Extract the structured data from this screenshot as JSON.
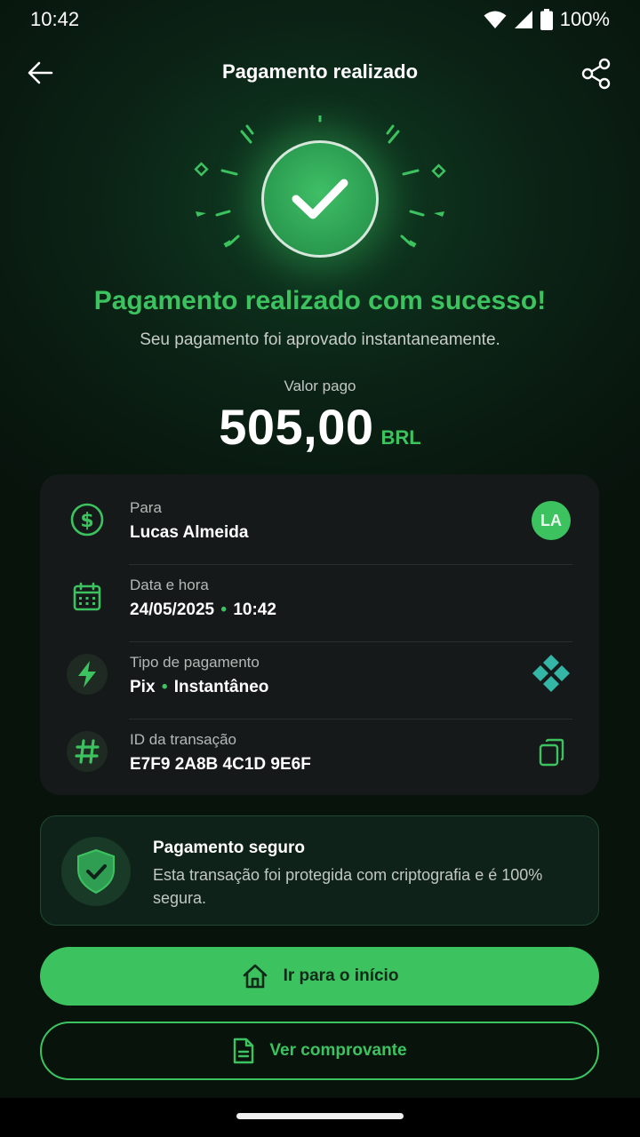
{
  "status_bar": {
    "time": "10:42",
    "battery": "100%"
  },
  "app_bar": {
    "title": "Pagamento realizado"
  },
  "hero": {
    "title": "Pagamento realizado com sucesso!",
    "subtitle": "Seu pagamento foi aprovado instantaneamente."
  },
  "amount": {
    "label": "Valor pago",
    "value": "505,00",
    "currency": "BRL"
  },
  "details": {
    "recipient": {
      "label": "Para",
      "value": "Lucas Almeida",
      "avatar_initials": "LA"
    },
    "datetime": {
      "label": "Data e hora",
      "date": "24/05/2025",
      "time": "10:42"
    },
    "payment_type": {
      "label": "Tipo de pagamento",
      "method": "Pix",
      "speed": "Instantâneo"
    },
    "transaction": {
      "label": "ID da transação",
      "value": "E7F9 2A8B 4C1D 9E6F"
    }
  },
  "secure": {
    "title": "Pagamento seguro",
    "text": "Esta transação foi protegida com criptografia e é 100% segura."
  },
  "actions": {
    "home_label": "Ir para o início",
    "receipt_label": "Ver comprovante"
  },
  "icons": {
    "back": "arrow-left-icon",
    "share": "share-icon",
    "success": "check-icon",
    "recipient": "dollar-circle-icon",
    "datetime": "calendar-icon",
    "payment": "lightning-icon",
    "transaction": "hash-icon",
    "copy": "copy-icon",
    "pix": "pix-logo-icon",
    "secure": "shield-check-icon",
    "home": "home-icon",
    "receipt": "document-icon"
  },
  "colors": {
    "accent": "#3cc35f",
    "background": "#0b1f14",
    "card": "#16191a"
  }
}
